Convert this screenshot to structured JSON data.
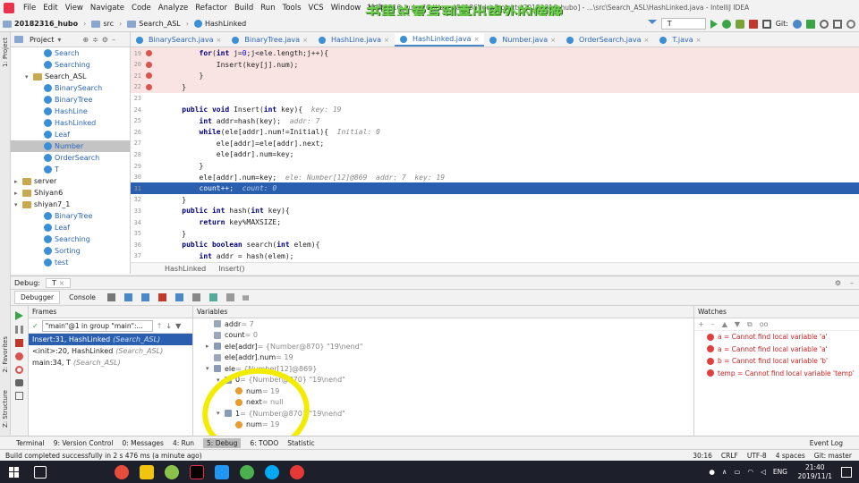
{
  "menu": [
    "File",
    "Edit",
    "View",
    "Navigate",
    "Code",
    "Analyze",
    "Refactor",
    "Build",
    "Run",
    "Tools",
    "VCS",
    "Window",
    "Help"
  ],
  "window_title": "20182316_hubo [C:\\Users\\86186\\IdeaProjects\\20182316_hubo] - ...\\src\\Search_ASL\\HashLinked.java - IntelliJ IDEA",
  "watermark": "书里总爱写到喜出望外的傍晚",
  "breadcrumb": [
    "20182316_hubo",
    "src",
    "Search_ASL",
    "HashLinked"
  ],
  "run_config": "T",
  "git_label": "Git:",
  "project_panel": {
    "title": "Project"
  },
  "tree": [
    {
      "label": "Search",
      "indent": 2,
      "type": "class"
    },
    {
      "label": "Searching",
      "indent": 2,
      "type": "class"
    },
    {
      "label": "Search_ASL",
      "indent": 1,
      "type": "pkg",
      "arrow": "▾"
    },
    {
      "label": "BinarySearch",
      "indent": 2,
      "type": "class"
    },
    {
      "label": "BinaryTree",
      "indent": 2,
      "type": "class"
    },
    {
      "label": "HashLine",
      "indent": 2,
      "type": "class"
    },
    {
      "label": "HashLinked",
      "indent": 2,
      "type": "class"
    },
    {
      "label": "Leaf",
      "indent": 2,
      "type": "class"
    },
    {
      "label": "Number",
      "indent": 2,
      "type": "class",
      "selected": true
    },
    {
      "label": "OrderSearch",
      "indent": 2,
      "type": "class"
    },
    {
      "label": "T",
      "indent": 2,
      "type": "class"
    },
    {
      "label": "server",
      "indent": 0,
      "type": "pkg",
      "arrow": "▸"
    },
    {
      "label": "Shiyan6",
      "indent": 0,
      "type": "pkg",
      "arrow": "▸"
    },
    {
      "label": "shiyan7_1",
      "indent": 0,
      "type": "pkg",
      "arrow": "▾"
    },
    {
      "label": "BinaryTree",
      "indent": 2,
      "type": "class"
    },
    {
      "label": "Leaf",
      "indent": 2,
      "type": "class"
    },
    {
      "label": "Searching",
      "indent": 2,
      "type": "class"
    },
    {
      "label": "Sorting",
      "indent": 2,
      "type": "class"
    },
    {
      "label": "test",
      "indent": 2,
      "type": "class"
    }
  ],
  "tabs": [
    {
      "label": "BinarySearch.java"
    },
    {
      "label": "BinaryTree.java"
    },
    {
      "label": "HashLine.java"
    },
    {
      "label": "HashLinked.java",
      "active": true
    },
    {
      "label": "Number.java"
    },
    {
      "label": "OrderSearch.java"
    },
    {
      "label": "T.java"
    }
  ],
  "code_lines": [
    {
      "n": "19",
      "html": "        <span class='kw'>for</span>(<span class='kw'>int</span> j=<span class='num'>0</span>;j&lt;ele.length;j++){",
      "bp": true
    },
    {
      "n": "20",
      "html": "            Insert(key[j].num);",
      "bp": true
    },
    {
      "n": "21",
      "html": "        }",
      "bp": true
    },
    {
      "n": "22",
      "html": "    }",
      "bp": true
    },
    {
      "n": "23",
      "html": ""
    },
    {
      "n": "24",
      "html": "    <span class='kw'>public void</span> Insert(<span class='kw'>int</span> key){  <span class='hint'>key: 19</span>"
    },
    {
      "n": "25",
      "html": "        <span class='kw'>int</span> addr=hash(key);  <span class='hint'>addr: 7</span>"
    },
    {
      "n": "26",
      "html": "        <span class='kw'>while</span>(ele[addr].num!=Initial){  <span class='hint'>Initial: 0</span>"
    },
    {
      "n": "27",
      "html": "            ele[addr]=ele[addr].next;"
    },
    {
      "n": "28",
      "html": "            ele[addr].num=key;"
    },
    {
      "n": "29",
      "html": "        }"
    },
    {
      "n": "30",
      "html": "        ele[addr].num=key;  <span class='hint'>ele: Number[12]@869  addr: 7  key: 19</span>"
    },
    {
      "n": "31",
      "html": "        count++;  <span class='hint'>count: 0</span>",
      "exec": true
    },
    {
      "n": "32",
      "html": "    }"
    },
    {
      "n": "33",
      "html": "    <span class='kw'>public int</span> hash(<span class='kw'>int</span> key){"
    },
    {
      "n": "34",
      "html": "        <span class='kw'>return</span> key%MAXSIZE;"
    },
    {
      "n": "35",
      "html": "    }"
    },
    {
      "n": "36",
      "html": "    <span class='kw'>public boolean</span> search(<span class='kw'>int</span> elem){"
    },
    {
      "n": "37",
      "html": "        <span class='kw'>int</span> addr = hash(elem);"
    }
  ],
  "editor_breadcrumb": [
    "HashLinked",
    "Insert()"
  ],
  "debug": {
    "label": "Debug:",
    "session": "T",
    "tabs": [
      "Debugger",
      "Console"
    ]
  },
  "frames": {
    "header": "Frames",
    "thread": "\"main\"@1 in group \"main\":...",
    "rows": [
      {
        "method": "Insert:31, HashLinked",
        "loc": "(Search_ASL)",
        "selected": true
      },
      {
        "method": "<init>:20, HashLinked",
        "loc": "(Search_ASL)"
      },
      {
        "method": "main:34, T",
        "loc": "(Search_ASL)"
      }
    ]
  },
  "variables": {
    "header": "Variables",
    "rows": [
      {
        "indent": 0,
        "icon": "p",
        "name": "addr",
        "val": " = 7"
      },
      {
        "indent": 0,
        "icon": "p",
        "name": "count",
        "val": " = 0"
      },
      {
        "indent": 0,
        "icon": "o",
        "name": "ele[addr]",
        "val": " = {Number@870} \"19\\nend\"",
        "arrow": "▸"
      },
      {
        "indent": 0,
        "icon": "p",
        "name": "ele[addr].num",
        "val": " = 19"
      },
      {
        "indent": 0,
        "icon": "o",
        "name": "ele",
        "val": " = {Number[12]@869}",
        "arrow": "▾"
      },
      {
        "indent": 1,
        "icon": "o",
        "name": "0",
        "val": " = {Number@870} \"19\\nend\"",
        "arrow": "▾"
      },
      {
        "indent": 2,
        "icon": "f",
        "name": "num",
        "val": " = 19"
      },
      {
        "indent": 2,
        "icon": "f",
        "name": "next",
        "val": " = null"
      },
      {
        "indent": 1,
        "icon": "o",
        "name": "1",
        "val": " = {Number@870} \"19\\nend\"",
        "arrow": "▾"
      },
      {
        "indent": 2,
        "icon": "f",
        "name": "num",
        "val": " = 19"
      }
    ]
  },
  "watches": {
    "header": "Watches",
    "rows": [
      "a = Cannot find local variable 'a'",
      "a = Cannot find local variable 'a'",
      "b = Cannot find local variable 'b'",
      "temp = Cannot find local variable 'temp'"
    ]
  },
  "left_strip": [
    "1: Project",
    "2: Favorites",
    "Z: Structure"
  ],
  "toolwindows": [
    {
      "label": "Terminal"
    },
    {
      "label": "9: Version Control"
    },
    {
      "label": "0: Messages"
    },
    {
      "label": "4: Run"
    },
    {
      "label": "5: Debug",
      "active": true
    },
    {
      "label": "6: TODO"
    },
    {
      "label": "Statistic"
    }
  ],
  "event_log": "Event Log",
  "status": {
    "message": "Build completed successfully in 2 s 476 ms (a minute ago)",
    "pos": "30:16",
    "sep": "CRLF",
    "enc": "UTF-8",
    "indent": "4 spaces",
    "git": "Git: master"
  },
  "taskbar": {
    "time": "21:40",
    "date": "2019/11/1",
    "lang": "ENG"
  },
  "colors": {
    "exec_line": "#2a5fb0",
    "breakpoint_bg": "#fae3e3",
    "highlight_circle": "#f3ec00",
    "watch_error": "#cc2222"
  }
}
